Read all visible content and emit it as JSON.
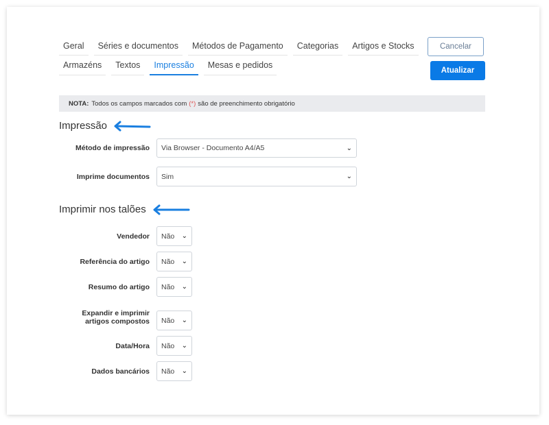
{
  "tabs_row1": [
    "Geral",
    "Séries e documentos",
    "Métodos de Pagamento",
    "Categorias",
    "Artigos e Stocks"
  ],
  "tabs_row2": [
    "Armazéns",
    "Textos",
    "Impressão",
    "Mesas e pedidos"
  ],
  "active_tab": "Impressão",
  "buttons": {
    "cancel": "Cancelar",
    "update": "Atualizar"
  },
  "note": {
    "bold": "NOTA:",
    "before": "Todos os campos marcados com",
    "required_mark": "(*)",
    "after": "são de preenchimento obrigatório"
  },
  "section_print": {
    "title": "Impressão",
    "fields": [
      {
        "label": "Método de impressão",
        "value": "Via Browser - Documento A4/A5"
      },
      {
        "label": "Imprime documentos",
        "value": "Sim"
      }
    ]
  },
  "section_receipts": {
    "title": "Imprimir nos talões",
    "fields": [
      {
        "label": "Vendedor",
        "value": "Não"
      },
      {
        "label": "Referência do artigo",
        "value": "Não"
      },
      {
        "label": "Resumo do artigo",
        "value": "Não"
      },
      {
        "label_line1": "Expandir e imprimir",
        "label_line2": "artigos compostos",
        "value": "Não"
      },
      {
        "label": "Data/Hora",
        "value": "Não"
      },
      {
        "label": "Dados bancários",
        "value": "Não"
      }
    ]
  },
  "colors": {
    "accent": "#0a7ae6",
    "arrow": "#1a7fe0",
    "required": "#e05555"
  }
}
